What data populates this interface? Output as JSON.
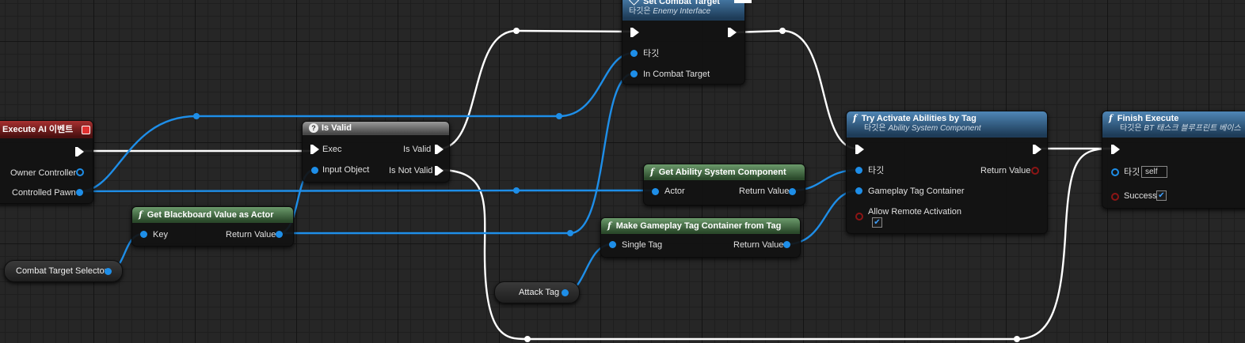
{
  "event_node": {
    "title": "Execute AI 이벤트",
    "pins": {
      "owner_controller": "Owner Controller",
      "controlled_pawn": "Controlled Pawn"
    }
  },
  "is_valid_node": {
    "title": "Is Valid",
    "pins": {
      "exec": "Exec",
      "input_object": "Input Object",
      "is_valid": "Is Valid",
      "is_not_valid": "Is Not Valid"
    }
  },
  "get_blackboard_node": {
    "title": "Get Blackboard Value as Actor",
    "pins": {
      "key": "Key",
      "return_value": "Return Value"
    }
  },
  "combat_target_selector": {
    "label": "Combat Target Selector"
  },
  "attack_tag": {
    "label": "Attack Tag"
  },
  "set_combat_target_node": {
    "title": "Set Combat Target",
    "subtitle_prefix": "타깃은",
    "subtitle_target": "Enemy Interface",
    "pins": {
      "target": "타깃",
      "in_combat_target": "In Combat Target"
    }
  },
  "get_asc_node": {
    "title": "Get Ability System Component",
    "pins": {
      "actor": "Actor",
      "return_value": "Return Value"
    }
  },
  "make_tag_container_node": {
    "title": "Make Gameplay Tag Container from Tag",
    "pins": {
      "single_tag": "Single Tag",
      "return_value": "Return Value"
    }
  },
  "try_activate_node": {
    "title": "Try Activate Abilities by Tag",
    "subtitle_prefix": "타깃은",
    "subtitle_target": "Ability System Component",
    "pins": {
      "target": "타깃",
      "return_value": "Return Value",
      "tag_container": "Gameplay Tag Container",
      "allow_remote": "Allow Remote Activation"
    },
    "allow_remote_checked": true
  },
  "finish_execute_node": {
    "title": "Finish Execute",
    "subtitle_prefix": "타깃은",
    "subtitle_target": "BT 태스크 블루프린트 베이스",
    "pins": {
      "target": "타깃",
      "success": "Success"
    },
    "target_value": "self",
    "success_checked": true
  },
  "colors": {
    "exec_wire": "#ffffff",
    "object_wire": "#1e8ee8",
    "function_header": "#3a6a94",
    "pure_header": "#4a7a4a",
    "event_header": "#8a2020",
    "bool_pin": "#8c1515"
  },
  "icons": {
    "function": "function-f-icon",
    "is_valid": "question-icon",
    "event": "event-red-square-icon",
    "interface": "interface-diamond-icon"
  }
}
